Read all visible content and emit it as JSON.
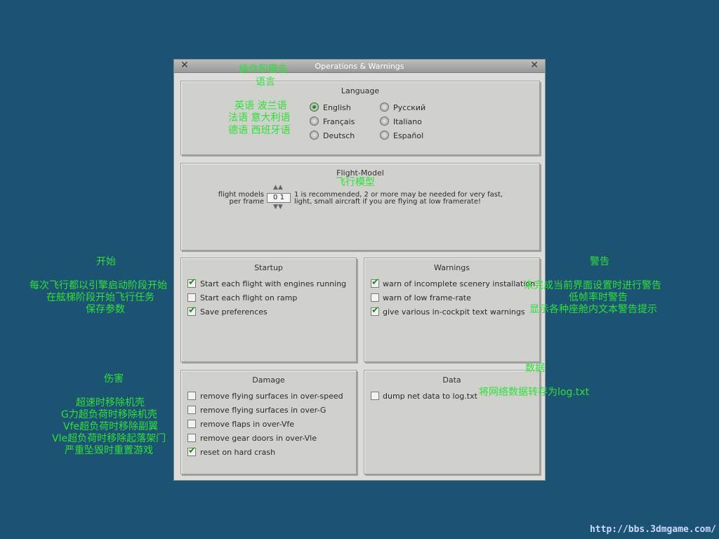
{
  "window": {
    "title": "Operations & Warnings",
    "close_left": "✕",
    "close_right": "✕"
  },
  "language": {
    "title": "Language",
    "options": [
      "English",
      "Français",
      "Deutsch",
      "Русский",
      "Italiano",
      "Español"
    ],
    "selected": "English"
  },
  "flight_model": {
    "title": "Flight-Model",
    "label_line1": "flight models",
    "label_line2": "per frame",
    "value": "0 1",
    "note_line1": "1 is recommended, 2 or more may be needed for very fast,",
    "note_line2": "light, small aircraft if you are flying at low framerate!"
  },
  "startup": {
    "title": "Startup",
    "items": [
      {
        "label": "Start each flight with engines running",
        "checked": true
      },
      {
        "label": "Start each flight on ramp",
        "checked": false
      },
      {
        "label": "Save preferences",
        "checked": true
      }
    ]
  },
  "warnings": {
    "title": "Warnings",
    "items": [
      {
        "label": "warn of incomplete scenery installation",
        "checked": true
      },
      {
        "label": "warn of low frame-rate",
        "checked": false
      },
      {
        "label": "give various in-cockpit text warnings",
        "checked": true
      }
    ]
  },
  "damage": {
    "title": "Damage",
    "items": [
      {
        "label": "remove flying surfaces in over-speed",
        "checked": false
      },
      {
        "label": "remove flying surfaces in over-G",
        "checked": false
      },
      {
        "label": "remove flaps in over-Vfe",
        "checked": false
      },
      {
        "label": "remove gear doors in over-Vle",
        "checked": false
      },
      {
        "label": "reset on hard crash",
        "checked": true
      }
    ]
  },
  "data": {
    "title": "Data",
    "items": [
      {
        "label": "dump net data to log.txt",
        "checked": false
      }
    ]
  },
  "annotations": {
    "title": "操作和警告",
    "language": "语言",
    "lang_row1": "英语   波兰语",
    "lang_row2": "法语   意大利语",
    "lang_row3": "德语   西班牙语",
    "flight_model": "飞行模型",
    "startup": "开始",
    "startup_1": "每次飞行都以引擎启动阶段开始",
    "startup_2": "在舷梯阶段开始飞行任务",
    "startup_3": "保存参数",
    "warnings": "警告",
    "warnings_1": "未完成当前界面设置时进行警告",
    "warnings_2": "低帧率时警告",
    "warnings_3": "显示各种座舱内文本警告提示",
    "damage": "伤害",
    "damage_1": "超速时移除机壳",
    "damage_2": "G力超负荷时移除机壳",
    "damage_3": "Vfe超负荷时移除副翼",
    "damage_4": "Vle超负荷时移除起落架门",
    "damage_5": "严重坠毁时重置游戏",
    "data": "数据",
    "data_1": "将网络数据转存为log.txt"
  },
  "watermark": "http://bbs.3dmgame.com/",
  "colors": {
    "background": "#1c5272",
    "annotation": "#2fe03a",
    "check": "#1a8a1a"
  }
}
